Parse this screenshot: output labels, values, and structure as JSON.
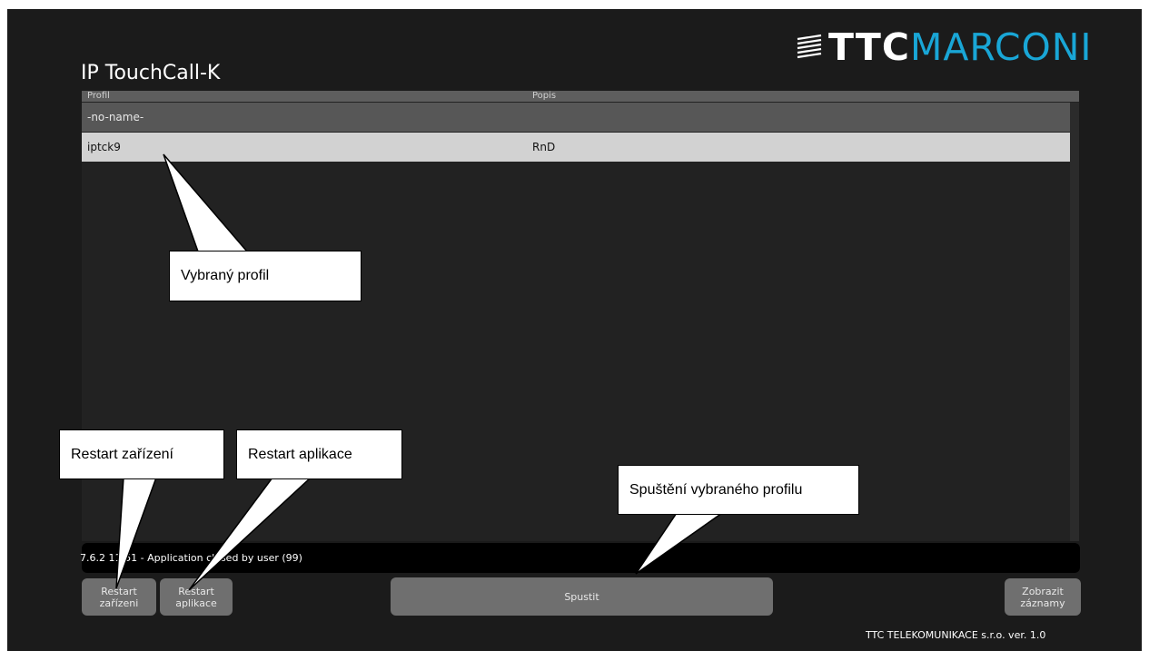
{
  "brand": {
    "ttc": "TTC",
    "marconi": "MARCONI"
  },
  "app_title": "IP TouchCall-K",
  "table": {
    "columns": [
      "Profil",
      "Popis"
    ],
    "rows": [
      {
        "profil": "-no-name-",
        "popis": ""
      },
      {
        "profil": "iptck9",
        "popis": "RnD"
      }
    ]
  },
  "status_line": "7.6.2  11:51 - Application closed by user (99)",
  "buttons": {
    "restart_device": "Restart\nzařízeni",
    "restart_app": "Restart\naplikace",
    "start": "Spustit",
    "show_records": "Zobrazit\nzáznamy"
  },
  "footer": "TTC TELEKOMUNIKACE s.r.o. ver. 1.0",
  "callouts": {
    "selected_profile": "Vybraný profil",
    "restart_device": "Restart zařízení",
    "restart_app": "Restart aplikace",
    "start_profile": "Spuštění vybraného profilu"
  },
  "colors": {
    "accent": "#19a6d6",
    "selected_row": "#d2d2d2",
    "button": "#6f6f6f"
  }
}
